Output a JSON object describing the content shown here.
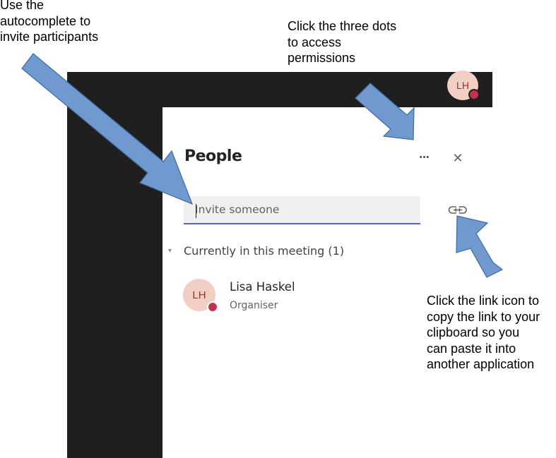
{
  "app": {
    "user_initials": "LH",
    "status_color": "#c4314b",
    "accent_color": "#5b5fc7"
  },
  "panel": {
    "title": "People",
    "more_icon": "more-horizontal-icon",
    "more_glyph": "•••",
    "close_icon": "close-icon",
    "close_glyph": "✕",
    "invite_placeholder": "Invite someone",
    "link_icon": "link-icon"
  },
  "meeting": {
    "section_label": "Currently in this meeting (1)",
    "caret_glyph": "▾",
    "participants": [
      {
        "initials": "LH",
        "name": "Lisa Haskel",
        "role": "Organiser"
      }
    ]
  },
  "annotations": {
    "left": "Use the\nautocomplete to\ninvite participants",
    "top": "Click the three dots\nto access\npermissions",
    "right": "Click the link icon to\ncopy the link to your\nclipboard so you\ncan paste it into\nanother application",
    "arrow_color": "#7099d0"
  }
}
